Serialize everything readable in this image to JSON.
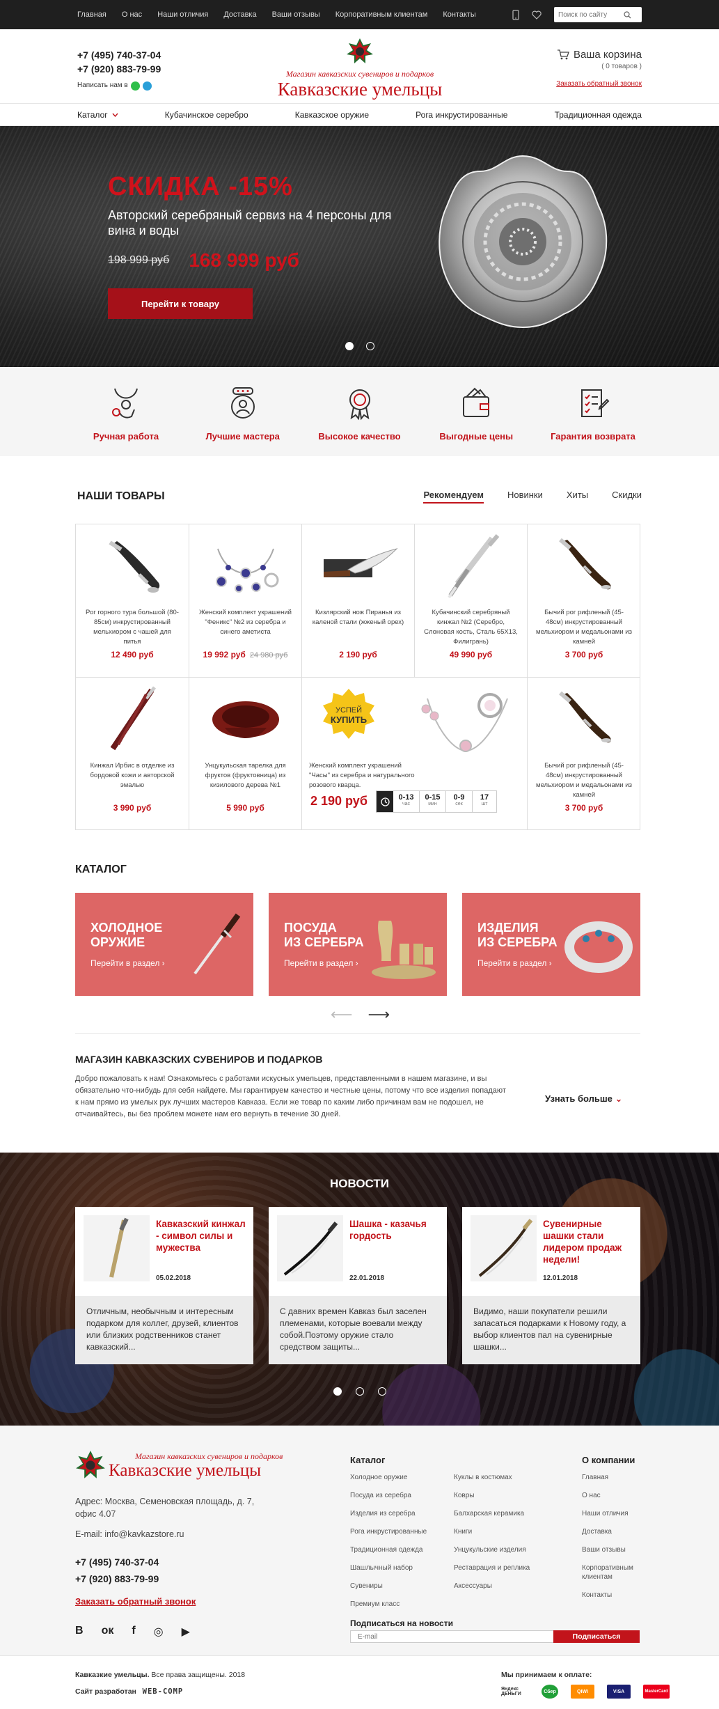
{
  "topbar": {
    "nav": [
      "Главная",
      "О нас",
      "Наши отличия",
      "Доставка",
      "Ваши отзывы",
      "Корпоративным клиентам",
      "Контакты"
    ],
    "search_placeholder": "Поиск по сайту"
  },
  "header": {
    "phone1": "+7 (495) 740-37-04",
    "phone2": "+7 (920) 883-79-99",
    "write_us": "Написать нам в",
    "logo_small": "Магазин кавказских сувениров и подарков",
    "logo_big": "Кавказские умельцы",
    "cart_title": "Ваша корзина",
    "cart_count": "( 0 товаров )",
    "callback": "Заказать обратный звонок"
  },
  "mainnav": [
    "Каталог",
    "Кубачинское серебро",
    "Кавказское оружие",
    "Рога инкрустированные",
    "Традиционная одежда"
  ],
  "hero": {
    "sale": "СКИДКА -15%",
    "desc": "Авторский серебряный сервиз на 4 персоны для вина и воды",
    "old_price": "198 999 руб",
    "new_price": "168 999 руб",
    "button": "Перейти к товару"
  },
  "features": [
    "Ручная работа",
    "Лучшие мастера",
    "Высокое качество",
    "Выгодные цены",
    "Гарантия возврата"
  ],
  "products": {
    "title": "НАШИ ТОВАРЫ",
    "tabs": [
      "Рекомендуем",
      "Новинки",
      "Хиты",
      "Скидки"
    ],
    "items": [
      {
        "name": "Рог горного тура большой (80-85см) инкрустированный мельхиором с чашей для питья",
        "price": "12 490 руб",
        "old": ""
      },
      {
        "name": "Женский комплект украшений \"Феникс\" №2 из серебра и синего аметиста",
        "price": "19 992 руб",
        "old": "24 980 руб"
      },
      {
        "name": "Кизлярский нож Пиранья из каленой стали (жженый орех)",
        "price": "2 190 руб",
        "old": ""
      },
      {
        "name": "Кубачинский серебряный кинжал №2 (Серебро, Слоновая кость, Сталь 65Х13, Филигрань)",
        "price": "49 990 руб",
        "old": ""
      },
      {
        "name": "Бычий рог рифленый (45-48см) инкрустированный мельхиором и медальонами из камней",
        "price": "3 700 руб",
        "old": ""
      },
      {
        "name": "Кинжал Ирбис в отделке из бордовой кожи и авторской эмалью",
        "price": "3 990 руб",
        "old": ""
      },
      {
        "name": "Унцукульская тарелка для фруктов (фруктовница) из кизилового дерева №1",
        "price": "5 990 руб",
        "old": ""
      },
      {
        "name": "Бычий рог рифленый (45-48см) инкрустированный мельхиором и медальонами из камней",
        "price": "3 700 руб",
        "old": ""
      }
    ],
    "promo": {
      "badge1": "УСПЕЙ",
      "badge2": "КУПИТЬ",
      "name": "Женский комплект украшений \"Часы\" из серебра и натурального розового кварца.",
      "price": "2 190 руб",
      "timer": [
        {
          "v": "0-13",
          "l": "час"
        },
        {
          "v": "0-15",
          "l": "мин"
        },
        {
          "v": "0-9",
          "l": "сек"
        },
        {
          "v": "17",
          "l": "шт"
        }
      ]
    }
  },
  "catalog": {
    "title": "КАТАЛОГ",
    "items": [
      {
        "name1": "ХОЛОДНОЕ",
        "name2": "ОРУЖИЕ",
        "link": "Перейти в раздел"
      },
      {
        "name1": "ПОСУДА",
        "name2": "ИЗ СЕРЕБРА",
        "link": "Перейти в раздел"
      },
      {
        "name1": "ИЗДЕЛИЯ",
        "name2": "ИЗ СЕРЕБРА",
        "link": "Перейти в раздел"
      }
    ]
  },
  "about": {
    "title": "МАГАЗИН КАВКАЗСКИХ СУВЕНИРОВ И ПОДАРКОВ",
    "text": "Добро пожаловать к нам! Ознакомьтесь с работами искусных умельцев, представленными в нашем магазине, и вы обязательно что-нибудь для себя найдете. Мы гарантируем качество и честные цены, потому что все изделия попадают к нам прямо из умелых рук лучших мастеров Кавказа. Если же товар по каким либо причинам вам не подошел, не отчаивайтесь, вы без проблем можете нам его вернуть в течение 30 дней.",
    "more": "Узнать больше"
  },
  "news": {
    "title": "НОВОСТИ",
    "items": [
      {
        "head": "Кавказский кинжал - символ силы и мужества",
        "date": "05.02.2018",
        "body": "Отличным, необычным и интересным подарком для коллег, друзей, клиентов или близких родственников станет кавказский..."
      },
      {
        "head": "Шашка - казачья гордость",
        "date": "22.01.2018",
        "body": "С давних времен Кавказ был заселен племенами, которые воевали между собой.Поэтому оружие стало средством защиты..."
      },
      {
        "head": "Сувенирные шашки стали лидером продаж недели!",
        "date": "12.01.2018",
        "body": "Видимо, наши покупатели решили запасаться подарками к Новому году, а выбор клиентов пал на сувенирные шашки..."
      }
    ]
  },
  "footer": {
    "logo_small": "Магазин кавказских сувениров и подарков",
    "logo_big": "Кавказские умельцы",
    "address": "Адрес: Москва, Семеновская площадь, д. 7, офис 4.07",
    "email": "E-mail:  info@kavkazstore.ru",
    "phone1": "+7 (495) 740-37-04",
    "phone2": "+7 (920) 883-79-99",
    "callback": "Заказать обратный звонок",
    "social": [
      "В",
      "ок",
      "f",
      "◎",
      "▶"
    ],
    "catalog_title": "Каталог",
    "catalog_col1": [
      "Холодное оружие",
      "Посуда из серебра",
      "Изделия из серебра",
      "Рога инкрустированные",
      "Традиционная одежда",
      "Шашлычный набор",
      "Сувениры",
      "Премиум класс"
    ],
    "catalog_col2": [
      "Куклы в костюмах",
      "Ковры",
      "Балхарская керамика",
      "Книги",
      "Унцукульские изделия",
      "Реставрация и реплика",
      "Аксессуары"
    ],
    "company_title": "О компании",
    "company": [
      "Главная",
      "О нас",
      "Наши отличия",
      "Доставка",
      "Ваши отзывы",
      "Корпоративным клиентам",
      "Контакты"
    ],
    "subscribe_title": "Подписаться на новости",
    "subscribe_placeholder": "E-mail",
    "subscribe_button": "Подписаться",
    "copyright_brand": "Кавказкие умельцы.",
    "copyright_rest": " Все права защищены. 2018",
    "dev_label": "Сайт разработан",
    "dev_name": "WEB-COMP",
    "pay_title": "Мы принимаем к оплате:",
    "pay": [
      "Яндекс ДЕНЬГИ",
      "Сбер",
      "QIWI",
      "VISA",
      "MasterCard"
    ]
  },
  "colors": {
    "accent": "#c2141b",
    "catalog_tile": "#dd6665",
    "topbar": "#1f1f1f"
  }
}
